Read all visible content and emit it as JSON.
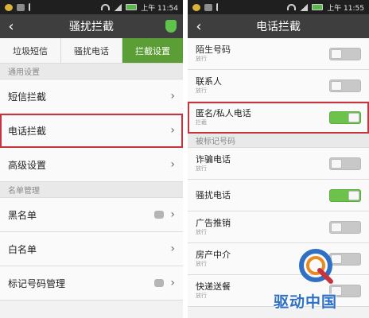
{
  "left": {
    "status_time": "上午 11:54",
    "title": "骚扰拦截",
    "tabs": [
      {
        "label": "垃圾短信"
      },
      {
        "label": "骚扰电话"
      },
      {
        "label": "拦截设置"
      }
    ],
    "section_general": "通用设置",
    "rows_general": [
      {
        "label": "短信拦截"
      },
      {
        "label": "电话拦截"
      },
      {
        "label": "高级设置"
      }
    ],
    "section_list": "名单管理",
    "rows_list": [
      {
        "label": "黑名单"
      },
      {
        "label": "白名单"
      },
      {
        "label": "标记号码管理"
      }
    ]
  },
  "right": {
    "status_time": "上午 11:55",
    "title": "电话拦截",
    "items_top": [
      {
        "label": "陌生号码",
        "sub": "放行",
        "on": false
      },
      {
        "label": "联系人",
        "sub": "放行",
        "on": false
      },
      {
        "label": "匿名/私人电话",
        "sub": "拦截",
        "on": true
      }
    ],
    "section_marked": "被标记号码",
    "items_marked": [
      {
        "label": "诈骗电话",
        "sub": "放行",
        "on": false
      },
      {
        "label": "骚扰电话",
        "sub": "",
        "on": true
      },
      {
        "label": "广告推销",
        "sub": "放行",
        "on": false
      },
      {
        "label": "房产中介",
        "sub": "放行",
        "on": false
      },
      {
        "label": "快递送餐",
        "sub": "放行",
        "on": false
      }
    ]
  },
  "watermark": {
    "text": "驱动中国",
    "colors": {
      "blue": "#2f6fc4",
      "orange": "#e88a1e",
      "red": "#c8343d"
    }
  },
  "colors": {
    "accent_green": "#5c9e36",
    "toggle_on": "#6cc24a",
    "highlight_red": "#c8343d",
    "titlebar": "#3e3e3e"
  }
}
